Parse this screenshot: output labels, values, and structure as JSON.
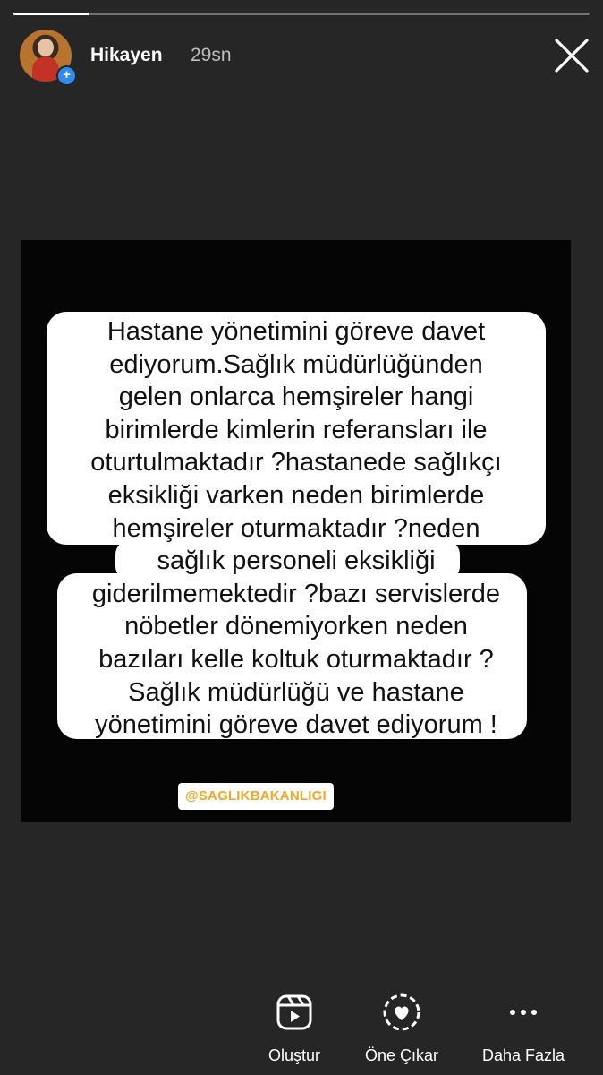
{
  "progress": {
    "fraction": 0.13
  },
  "header": {
    "username": "Hikayen",
    "timestamp": "29sn",
    "avatar_badge": "+"
  },
  "story": {
    "text": "Hastane yönetimini göreve davet\nediyorum.Sağlık müdürlüğünden\ngelen onlarca hemşireler hangi\nbirimlerde kimlerin referansları ile\noturtulmaktadır ?hastanede sağlıkçı\neksikliği varken neden birimlerde\nhemşireler oturmaktadır ?neden\nsağlık personeli eksikliği\ngiderilmemektedir ?bazı servislerde\nnöbetler dönemiyorken neden\nbazıları kelle koltuk oturmaktadır ?\nSağlık müdürlüğü ve hastane\nyönetimini göreve davet ediyorum !",
    "tag": "@SAGLIKBAKANLIGI"
  },
  "actions": [
    {
      "label": "Oluştur",
      "icon": "reels-icon"
    },
    {
      "label": "Öne Çıkar",
      "icon": "highlight-heart-icon"
    },
    {
      "label": "Daha Fazla",
      "icon": "more-dots-icon"
    }
  ],
  "colors": {
    "background": "#262626",
    "badge": "#2f8cf0",
    "tag_text": "#f5a623"
  }
}
